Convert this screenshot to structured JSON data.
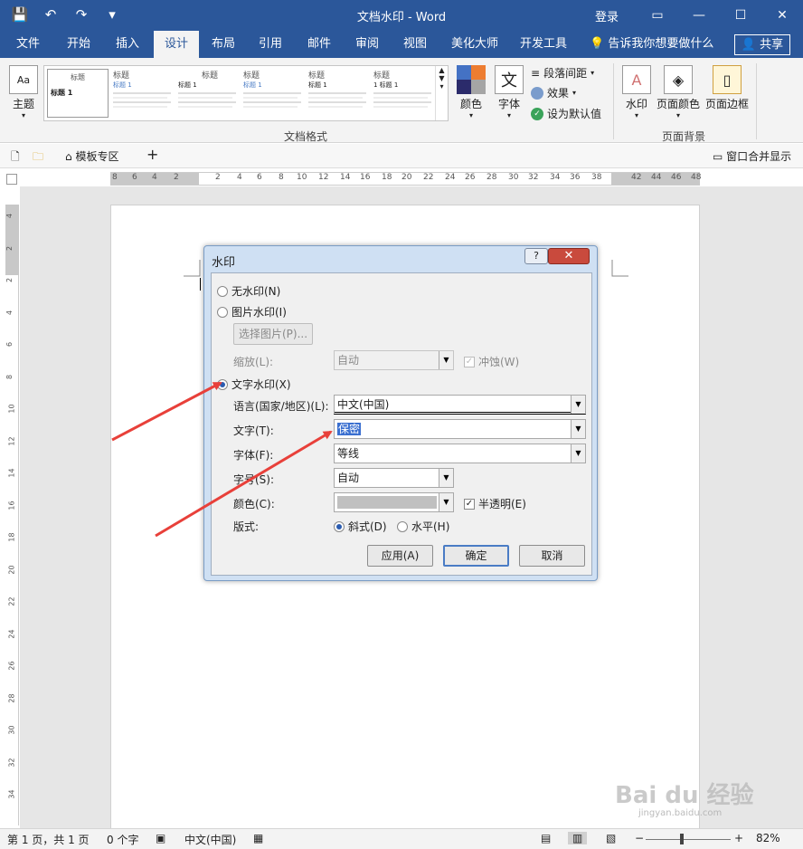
{
  "titlebar": {
    "title": "文档水印 - Word",
    "login": "登录",
    "qat_save": "💾",
    "qat_undo": "↶",
    "qat_redo": "↷",
    "qat_more": "▾",
    "ctrl_ribbon": "▭",
    "ctrl_min": "—",
    "ctrl_max": "☐",
    "ctrl_close": "✕"
  },
  "tabs": {
    "file": "文件",
    "home": "开始",
    "insert": "插入",
    "design": "设计",
    "layout": "布局",
    "references": "引用",
    "mailings": "邮件",
    "review": "审阅",
    "view": "视图",
    "beautify": "美化大师",
    "developer": "开发工具",
    "tellme": "告诉我你想要做什么",
    "share": "共享"
  },
  "ribbon": {
    "theme": "主题",
    "gallery_first_title": "标题",
    "gallery_first_heading": "标题 1",
    "gallery_titles": [
      "标题",
      "标题",
      "标题",
      "标题",
      "标题"
    ],
    "gallery_sub": [
      "标题 1",
      "标题 1",
      "标题 1",
      "标题 1",
      "1 标题 1"
    ],
    "colors": "颜色",
    "fonts": "字体",
    "para_spacing": "段落间距",
    "effects": "效果",
    "set_default": "设为默认值",
    "group_doc_format": "文档格式",
    "watermark": "水印",
    "page_color": "页面颜色",
    "page_border": "页面边框",
    "group_page_bg": "页面背景",
    "fonts_icon": "文"
  },
  "docbar": {
    "template_zone": "模板专区",
    "add": "+",
    "merge_windows": "窗口合并显示"
  },
  "ruler": {
    "h_numbers": [
      "8",
      "6",
      "4",
      "2",
      "2",
      "4",
      "6",
      "8",
      "10",
      "12",
      "14",
      "16",
      "18",
      "20",
      "22",
      "24",
      "26",
      "28",
      "30",
      "32",
      "34",
      "36",
      "38",
      "42",
      "44",
      "46",
      "48"
    ],
    "v_numbers": [
      "4",
      "2",
      "2",
      "4",
      "6",
      "8",
      "10",
      "12",
      "14",
      "16",
      "18",
      "20",
      "22",
      "24",
      "26",
      "28",
      "30",
      "32",
      "34"
    ]
  },
  "dialog": {
    "title": "水印",
    "help": "?",
    "close": "✕",
    "no_watermark": "无水印(N)",
    "picture_watermark": "图片水印(I)",
    "select_picture": "选择图片(P)...",
    "scale_label": "缩放(L):",
    "scale_value": "自动",
    "washout": "冲蚀(W)",
    "text_watermark": "文字水印(X)",
    "language_label": "语言(国家/地区)(L):",
    "language_value": "中文(中国)",
    "text_label": "文字(T):",
    "text_value": "保密",
    "font_label": "字体(F):",
    "font_value": "等线",
    "size_label": "字号(S):",
    "size_value": "自动",
    "color_label": "颜色(C):",
    "semitransparent": "半透明(E)",
    "layout_label": "版式:",
    "diagonal": "斜式(D)",
    "horizontal": "水平(H)",
    "apply": "应用(A)",
    "ok": "确定",
    "cancel": "取消",
    "selected_option": "text_watermark",
    "arrow_color": "#e8403a"
  },
  "statusbar": {
    "pages": "第 1 页，共 1 页",
    "words": "0 个字",
    "language": "中文(中国)",
    "zoom_minus": "−",
    "zoom_plus": "+",
    "zoom": "82%"
  },
  "watermark_brand": {
    "main": "Bai du 经验",
    "sub": "jingyan.baidu.com"
  }
}
